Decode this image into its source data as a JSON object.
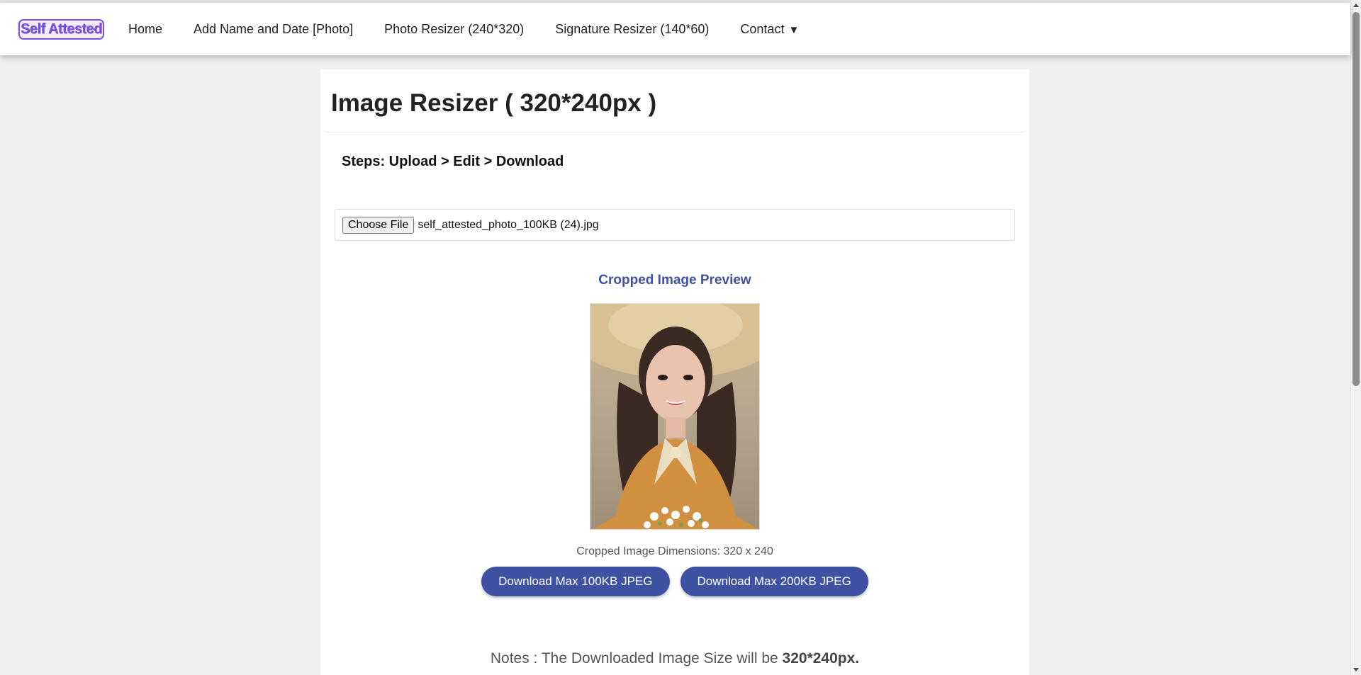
{
  "navbar": {
    "logo_text": "Self Attested",
    "links": [
      {
        "label": "Home"
      },
      {
        "label": "Add Name and Date [Photo]"
      },
      {
        "label": "Photo Resizer (240*320)"
      },
      {
        "label": "Signature Resizer (140*60)"
      },
      {
        "label": "Contact"
      }
    ],
    "contact_caret": "▼"
  },
  "main": {
    "title": "Image Resizer ( 320*240px )",
    "steps": "Steps: Upload > Edit > Download",
    "file_input": {
      "button_label": "Choose File",
      "file_name": "self_attested_photo_100KB (24).jpg"
    },
    "preview_title": "Cropped Image Preview",
    "dimensions_text": "Cropped Image Dimensions: 320 x 240",
    "buttons": {
      "download_100": "Download Max 100KB JPEG",
      "download_200": "Download Max 200KB JPEG"
    },
    "notes_prefix": "Notes : The Downloaded Image Size will be ",
    "notes_bold": "320*240px."
  },
  "colors": {
    "accent": "#3f51a3",
    "logo": "#7b4fe0",
    "background": "#f0f0f0"
  }
}
